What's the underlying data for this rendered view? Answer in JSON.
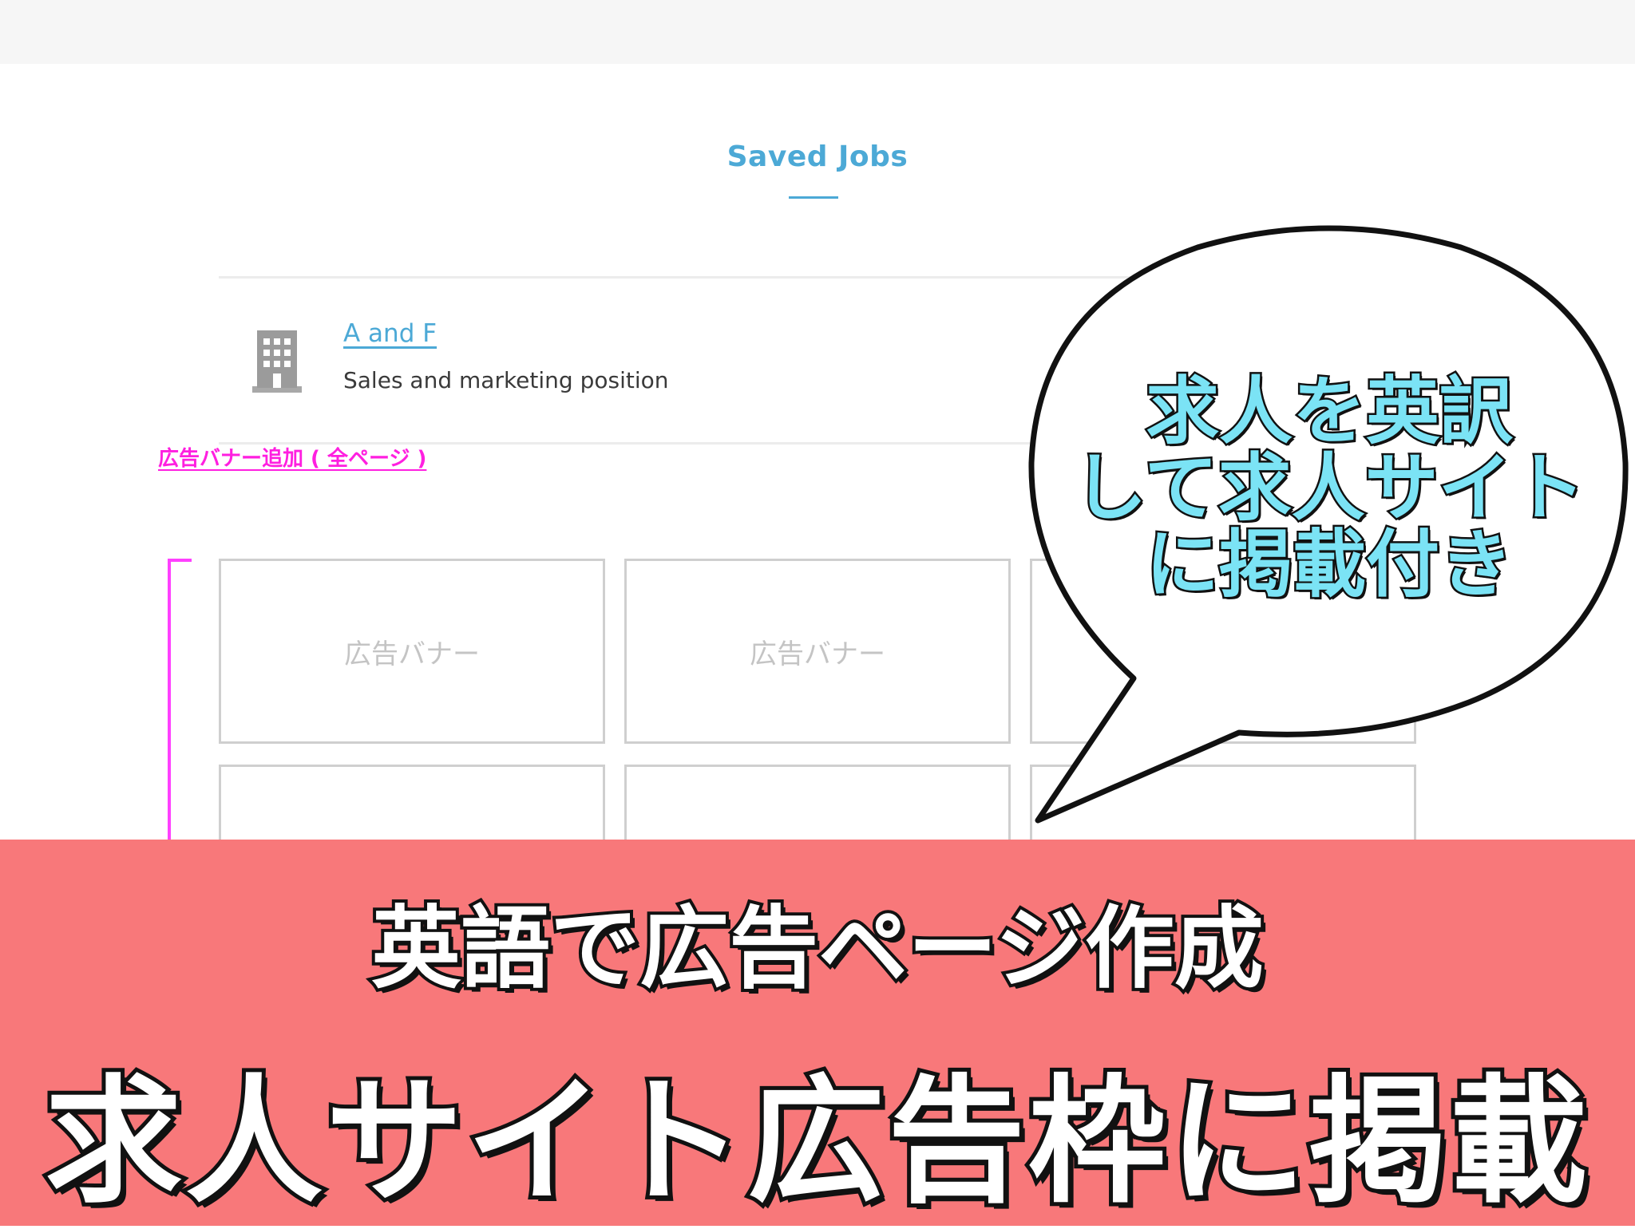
{
  "page": {
    "title": "Saved Jobs"
  },
  "job": {
    "company": "A and F",
    "description": "Sales and marketing position",
    "icon": "building-icon"
  },
  "ad_section": {
    "add_link": "広告バナー追加 ( 全ページ )",
    "banner_label": "広告バナー",
    "banners": [
      "広告バナー",
      "広告バナー",
      "",
      "",
      "",
      ""
    ]
  },
  "callout": {
    "lines": [
      "求人を英訳",
      "して求人サイト",
      "に掲載付き"
    ]
  },
  "headline": {
    "line1": "英語で広告ページ作成",
    "line2": "求人サイト広告枠に掲載"
  },
  "colors": {
    "accent": "#4ca9d6",
    "link_magenta": "#ff1fe0",
    "band": "#f8787a",
    "callout_text": "#7be3f5"
  }
}
